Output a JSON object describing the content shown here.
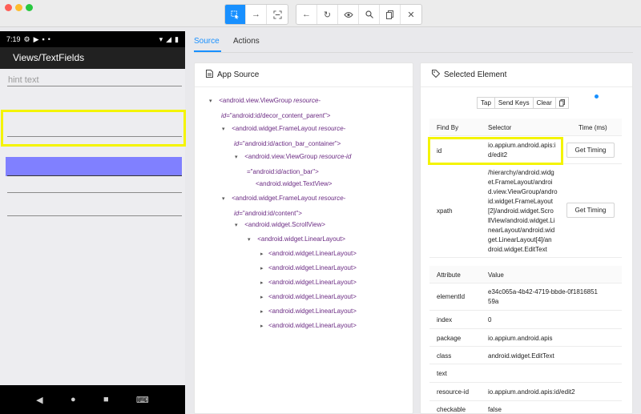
{
  "toolbar": {
    "icons": [
      "select-element-icon",
      "swipe-icon",
      "tap-coordinates-icon",
      "back-icon",
      "refresh-icon",
      "show-hide-icon",
      "search-icon",
      "copy-xml-icon",
      "quit-icon"
    ]
  },
  "device": {
    "time": "7:19",
    "app_title": "Views/TextFields",
    "hint_text": "hint text"
  },
  "tabs": {
    "source": "Source",
    "actions": "Actions"
  },
  "app_source": {
    "title": "App Source",
    "nodes": [
      {
        "tag": "<android.view.ViewGroup",
        "attr": "resource-",
        "attr2": "id",
        "val": "=\"android:id/decor_content_parent\">"
      },
      {
        "tag": "<android.widget.FrameLayout",
        "attr": "resource-",
        "attr2": "id",
        "val": "=\"android:id/action_bar_container\">"
      },
      {
        "tag": "<android.view.ViewGroup",
        "attr": "resource-id",
        "val": "=\"android:id/action_bar\">"
      },
      {
        "tag": "<android.widget.TextView>"
      },
      {
        "tag": "<android.widget.FrameLayout",
        "attr": "resource-",
        "attr2": "id",
        "val": "=\"android:id/content\">"
      },
      {
        "tag": "<android.widget.ScrollView>"
      },
      {
        "tag": "<android.widget.LinearLayout>"
      },
      {
        "tag": "<android.widget.LinearLayout>"
      },
      {
        "tag": "<android.widget.LinearLayout>"
      },
      {
        "tag": "<android.widget.LinearLayout>"
      },
      {
        "tag": "<android.widget.LinearLayout>"
      },
      {
        "tag": "<android.widget.LinearLayout>"
      },
      {
        "tag": "<android.widget.LinearLayout>"
      }
    ]
  },
  "selected": {
    "title": "Selected Element",
    "buttons": {
      "tap": "Tap",
      "send_keys": "Send Keys",
      "clear": "Clear"
    },
    "find_header": {
      "find_by": "Find By",
      "selector": "Selector",
      "time": "Time (ms)"
    },
    "find_rows": [
      {
        "by": "id",
        "selector": "io.appium.android.apis:i\nd/edit2",
        "button": "Get Timing"
      },
      {
        "by": "xpath",
        "selector": "/hierarchy/android.widg\net.FrameLayout/androi\nd.view.ViewGroup/andro\nid.widget.FrameLayout\n[2]/android.widget.Scro\nllView/android.widget.Li\nnearLayout/android.wid\nget.LinearLayout[4]/an\ndroid.widget.EditText",
        "button": "Get Timing"
      }
    ],
    "attr_header": {
      "attribute": "Attribute",
      "value": "Value"
    },
    "attributes": [
      {
        "name": "elementId",
        "value": "e34c065a-4b42-4719-bbde-0f1816851\n59a"
      },
      {
        "name": "index",
        "value": "0"
      },
      {
        "name": "package",
        "value": "io.appium.android.apis"
      },
      {
        "name": "class",
        "value": "android.widget.EditText"
      },
      {
        "name": "text",
        "value": ""
      },
      {
        "name": "resource-id",
        "value": "io.appium.android.apis:id/edit2"
      },
      {
        "name": "checkable",
        "value": "false"
      }
    ]
  },
  "colors": {
    "accent": "#1890ff",
    "highlight": "#f4f400",
    "selected_element": "#8080ff",
    "xml_tag": "#6b2b83"
  }
}
